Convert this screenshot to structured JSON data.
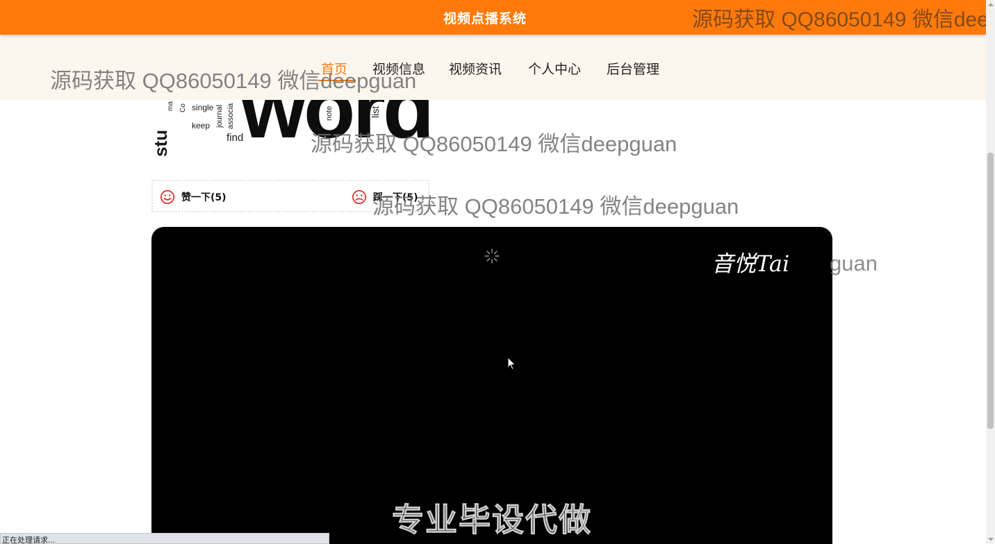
{
  "header": {
    "title": "视频点播系统",
    "watermark": "源码获取 QQ86050149 微信deepguan"
  },
  "nav": {
    "items": [
      {
        "label": "首页",
        "active": true
      },
      {
        "label": "视频信息",
        "active": false
      },
      {
        "label": "视频资讯",
        "active": false
      },
      {
        "label": "个人中心",
        "active": false
      },
      {
        "label": "后台管理",
        "active": false
      }
    ]
  },
  "watermark": {
    "text": "源码获取 QQ86050149 微信deepguan",
    "partial": "guan"
  },
  "cover": {
    "big_word": "word",
    "small_words": [
      "single",
      "keep",
      "find",
      "note",
      "list",
      "journal",
      "associa",
      "Co",
      "ma",
      "stu"
    ]
  },
  "votes": {
    "like_label": "赞一下(5)",
    "dislike_label": "踩一下(5)",
    "like_icon": "smile-icon",
    "dislike_icon": "frown-icon",
    "icon_color": "#e02424"
  },
  "video": {
    "logo_text": "音悦Tai",
    "subtitle": "专业毕设代做"
  },
  "status_bar": {
    "text": "正在处理请求..."
  },
  "colors": {
    "brand": "#ff7a0a",
    "nav_bg": "#fdf6ee",
    "accent_blue": "#2b6fd1"
  }
}
